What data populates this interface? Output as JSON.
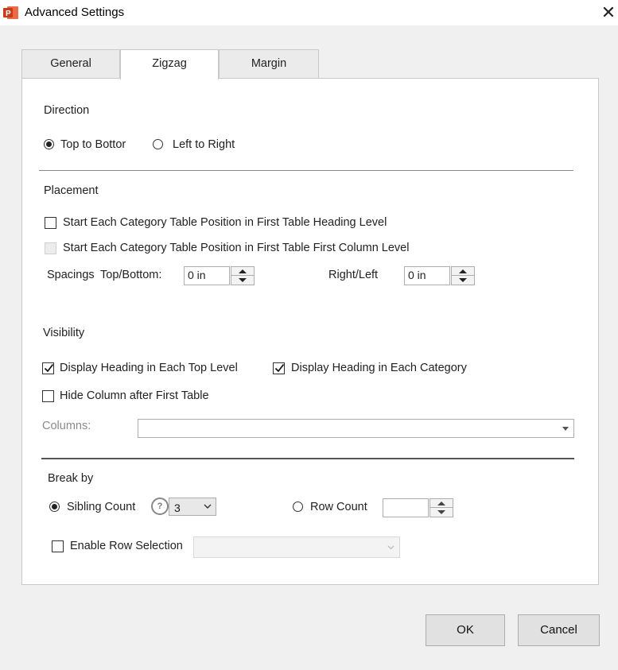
{
  "window": {
    "title": "Advanced Settings",
    "app_icon_letter": "P"
  },
  "tabs": [
    {
      "label": "General",
      "active": false
    },
    {
      "label": "Zigzag",
      "active": true
    },
    {
      "label": "Margin",
      "active": false
    }
  ],
  "direction": {
    "heading": "Direction",
    "options": [
      {
        "label": "Top to Bottor",
        "selected": true
      },
      {
        "label": "Left to Right",
        "selected": false
      }
    ]
  },
  "placement": {
    "heading": "Placement",
    "checkbox_heading_level": {
      "label": "Start Each Category Table Position in First Table Heading Level",
      "checked": false
    },
    "checkbox_first_column": {
      "label": "Start Each Category Table Position in First Table First Column Level",
      "checked": false,
      "disabled": true
    },
    "spacings_label": "Spacings",
    "top_bottom": {
      "label": "Top/Bottom:",
      "value": "0 in"
    },
    "right_left": {
      "label": "Right/Left",
      "value": "0 in"
    }
  },
  "visibility": {
    "heading": "Visibility",
    "display_heading_top": {
      "label": "Display Heading in Each Top Level",
      "checked": true
    },
    "display_heading_category": {
      "label": "Display Heading in Each Category",
      "checked": true
    },
    "hide_column": {
      "label": "Hide Column after First Table",
      "checked": false
    },
    "columns_label": "Columns:",
    "columns_value": ""
  },
  "break_by": {
    "heading": "Break by",
    "sibling_count": {
      "label": "Sibling Count",
      "selected": true,
      "value": "3",
      "help_icon": "question-circle"
    },
    "row_count": {
      "label": "Row Count",
      "selected": false,
      "value": ""
    },
    "enable_row_selection": {
      "label": "Enable Row Selection",
      "checked": false,
      "value": ""
    }
  },
  "buttons": {
    "ok": "OK",
    "cancel": "Cancel"
  },
  "colors": {
    "app_icon": "#d24726",
    "panel": "#ffffff",
    "background": "#f0f0f0"
  }
}
